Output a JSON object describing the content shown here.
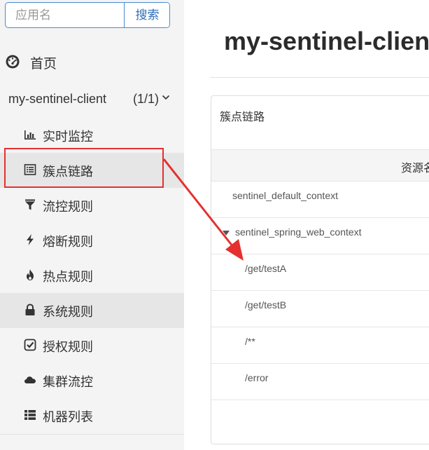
{
  "sidebar": {
    "search": {
      "placeholder": "应用名",
      "button_label": "搜索"
    },
    "home": {
      "icon": "dashboard-icon",
      "label": "首页"
    },
    "app_group": {
      "name": "my-sentinel-client",
      "count": "(1/1)",
      "expanded": true
    },
    "menu_items": [
      {
        "icon": "bar-chart-icon",
        "label": "实时监控"
      },
      {
        "icon": "list-icon",
        "label": "簇点链路"
      },
      {
        "icon": "filter-icon",
        "label": "流控规则"
      },
      {
        "icon": "bolt-icon",
        "label": "熔断规则"
      },
      {
        "icon": "fire-icon",
        "label": "热点规则"
      },
      {
        "icon": "lock-icon",
        "label": "系统规则"
      },
      {
        "icon": "check-square-icon",
        "label": "授权规则"
      },
      {
        "icon": "cloud-icon",
        "label": "集群流控"
      },
      {
        "icon": "th-list-icon",
        "label": "机器列表"
      }
    ],
    "next_group": {
      "name": "",
      "count": ""
    }
  },
  "main": {
    "page_title": "my-sentinel-client",
    "panel": {
      "title": "簇点链路",
      "column_header": "资源名",
      "rows": [
        {
          "label": "sentinel_default_context",
          "depth": 0,
          "expanded": null
        },
        {
          "label": "sentinel_spring_web_context",
          "depth": 0,
          "expanded": true
        },
        {
          "label": "/get/testA",
          "depth": 1,
          "expanded": null
        },
        {
          "label": "/get/testB",
          "depth": 1,
          "expanded": null
        },
        {
          "label": "/**",
          "depth": 1,
          "expanded": null
        },
        {
          "label": "/error",
          "depth": 1,
          "expanded": null
        }
      ]
    }
  },
  "colors": {
    "accent": "#4a8ad0",
    "annotation": "#e53030",
    "sidebar_bg": "#f4f4f4",
    "active_item_bg": "#e6e6e6"
  }
}
